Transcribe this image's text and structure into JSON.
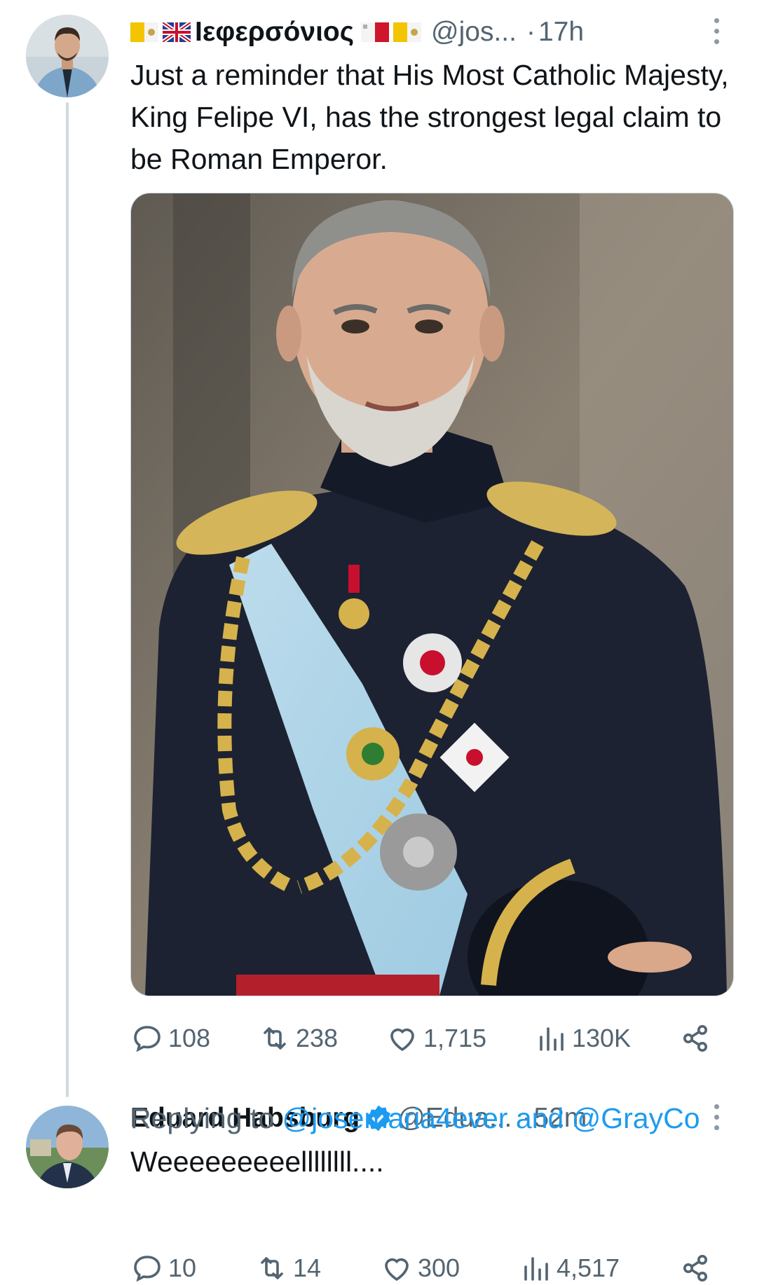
{
  "original_tweet": {
    "display_name": "Ιεφερσόνιος",
    "handle": "@jos...",
    "separator": "·",
    "time": "17h",
    "text": "Just a reminder that His Most Catholic Majesty, King Felipe VI, has the strongest legal claim to be Roman Emperor.",
    "icons": [
      "vatican-flag",
      "uk-flag",
      "malta-flag",
      "vatican-flag"
    ],
    "stats": {
      "replies": "108",
      "reposts": "238",
      "likes": "1,715",
      "views": "130K"
    }
  },
  "reply_tweet": {
    "display_name": "Eduard Habsburg",
    "handle": "@Edua...",
    "separator": "·",
    "time": "52m",
    "replying_prefix": "Replying to",
    "mentions": "@josemaria4ever and @GrayCo",
    "text": "Weeeeeeeeellllllll....",
    "stats": {
      "replies": "10",
      "reposts": "14",
      "likes": "300",
      "views": "4,517"
    }
  },
  "colors": {
    "text": "#0f1419",
    "secondary": "#536471",
    "link": "#1d9bf0",
    "thread_line": "#cfd9de"
  }
}
